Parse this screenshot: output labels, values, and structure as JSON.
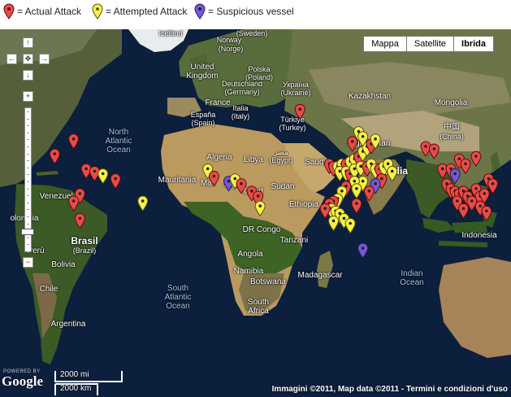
{
  "legend": {
    "actual": "= Actual Attack",
    "attempted": "= Attempted Attack",
    "suspicious": "= Suspicious vessel"
  },
  "colors": {
    "actual": "#e84b47",
    "attempted": "#f6f04b",
    "suspicious": "#7657d6",
    "ocean": "#0c1f3d"
  },
  "map_types": {
    "map": "Mappa",
    "satellite": "Satellite",
    "hybrid": "Ibrida",
    "selected": "Ibrida"
  },
  "labels": {
    "iceland": "Iceland",
    "sweden": "(Sweden)",
    "norway": "Norway",
    "norge": "(Norge)",
    "uk1": "United",
    "uk2": "Kingdom",
    "poland1": "Polska",
    "poland2": "(Poland)",
    "germany1": "Deutschland",
    "germany2": "(Germany)",
    "ukraine1": "Україна",
    "ukraine2": "(Ukraine)",
    "kazakhstan": "Kazakhstan",
    "france": "France",
    "italy1": "Italia",
    "italy2": "(Italy)",
    "spain1": "España",
    "spain2": "(Spain)",
    "turkey1": "Türkiye",
    "turkey2": "(Turkey)",
    "mongolia": "Mongolia",
    "china1": "中国",
    "china2": "(China)",
    "north_atlantic1": "North",
    "north_atlantic2": "Atlantic",
    "north_atlantic3": "Ocean",
    "algeria": "Algeria",
    "libya": "Libya",
    "egypt1": "مصر",
    "egypt2": "(Egypt)",
    "afghanistan": "Afghanistan",
    "saudi": "Saudi",
    "india": "India",
    "mauritania": "Mauritania",
    "mali": "Mali",
    "niger": "Niger",
    "chad": "Chad",
    "sudan": "Sudan",
    "venezuela": "Venezuela",
    "colombia": "olombia",
    "ethiopia": "Ethiopia",
    "drcongo": "DR Congo",
    "tanzania": "Tanzani",
    "brasil1": "Brasil",
    "brasil2": "(Brazil)",
    "peru": "Perú",
    "bolivia": "Bolivia",
    "angola": "Angola",
    "namibia": "Namibia",
    "botswana": "Botswana",
    "madagascar": "Madagascar",
    "indonesia": "Indonesia",
    "indian_ocean1": "Indian",
    "indian_ocean2": "Ocean",
    "chile": "Chile",
    "south_atlantic1": "South",
    "south_atlantic2": "Atlantic",
    "south_atlantic3": "Ocean",
    "south_africa1": "South",
    "south_africa2": "Africa",
    "argentina": "Argentina"
  },
  "footer": {
    "powered": "POWERED BY",
    "google": "Google",
    "scale_mi": "2000 mi",
    "scale_km": "2000 km",
    "copyright": "Immagini ©2011, Map data ©2011 - Termini e condizioni d'uso"
  },
  "markers": [
    {
      "t": "actual",
      "lon": -89,
      "lat": 18
    },
    {
      "t": "actual",
      "lon": -80,
      "lat": 24
    },
    {
      "t": "actual",
      "lon": -74,
      "lat": 12
    },
    {
      "t": "actual",
      "lon": -70,
      "lat": 11
    },
    {
      "t": "actual",
      "lon": -60,
      "lat": 8
    },
    {
      "t": "actual",
      "lon": -77,
      "lat": 2
    },
    {
      "t": "actual",
      "lon": -80,
      "lat": -1
    },
    {
      "t": "actual",
      "lon": -77,
      "lat": -8
    },
    {
      "t": "attempted",
      "lon": -66,
      "lat": 10
    },
    {
      "t": "attempted",
      "lon": -47,
      "lat": -1
    },
    {
      "t": "attempted",
      "lon": -16,
      "lat": 12
    },
    {
      "t": "actual",
      "lon": -13,
      "lat": 9
    },
    {
      "t": "suspicious",
      "lon": -6,
      "lat": 7
    },
    {
      "t": "attempted",
      "lon": -3,
      "lat": 8
    },
    {
      "t": "actual",
      "lon": 0,
      "lat": 6
    },
    {
      "t": "actual",
      "lon": 5,
      "lat": 3
    },
    {
      "t": "actual",
      "lon": 8,
      "lat": 1
    },
    {
      "t": "attempted",
      "lon": 9,
      "lat": -3
    },
    {
      "t": "actual",
      "lon": 28,
      "lat": 36
    },
    {
      "t": "actual",
      "lon": 42,
      "lat": 14
    },
    {
      "t": "actual",
      "lon": 44,
      "lat": 13
    },
    {
      "t": "attempted",
      "lon": 46,
      "lat": 13
    },
    {
      "t": "attempted",
      "lon": 48,
      "lat": 14
    },
    {
      "t": "actual",
      "lon": 50,
      "lat": 14
    },
    {
      "t": "attempted",
      "lon": 52,
      "lat": 15
    },
    {
      "t": "attempted",
      "lon": 54,
      "lat": 16
    },
    {
      "t": "actual",
      "lon": 56,
      "lat": 17
    },
    {
      "t": "attempted",
      "lon": 58,
      "lat": 19
    },
    {
      "t": "attempted",
      "lon": 60,
      "lat": 21
    },
    {
      "t": "actual",
      "lon": 62,
      "lat": 22
    },
    {
      "t": "attempted",
      "lon": 64,
      "lat": 24
    },
    {
      "t": "attempted",
      "lon": 56,
      "lat": 27
    },
    {
      "t": "attempted",
      "lon": 58,
      "lat": 25
    },
    {
      "t": "actual",
      "lon": 53,
      "lat": 23
    },
    {
      "t": "attempted",
      "lon": 47,
      "lat": 11
    },
    {
      "t": "attempted",
      "lon": 50,
      "lat": 11
    },
    {
      "t": "actual",
      "lon": 52,
      "lat": 10
    },
    {
      "t": "attempted",
      "lon": 54,
      "lat": 12
    },
    {
      "t": "attempted",
      "lon": 57,
      "lat": 13
    },
    {
      "t": "actual",
      "lon": 60,
      "lat": 13
    },
    {
      "t": "attempted",
      "lon": 62,
      "lat": 14
    },
    {
      "t": "attempted",
      "lon": 64,
      "lat": 12
    },
    {
      "t": "actual",
      "lon": 66,
      "lat": 12
    },
    {
      "t": "attempted",
      "lon": 68,
      "lat": 13
    },
    {
      "t": "attempted",
      "lon": 70,
      "lat": 14
    },
    {
      "t": "attempted",
      "lon": 72,
      "lat": 11
    },
    {
      "t": "actual",
      "lon": 67,
      "lat": 8
    },
    {
      "t": "suspicious",
      "lon": 64,
      "lat": 6
    },
    {
      "t": "attempted",
      "lon": 58,
      "lat": 7
    },
    {
      "t": "attempted",
      "lon": 54,
      "lat": 7
    },
    {
      "t": "actual",
      "lon": 50,
      "lat": 5
    },
    {
      "t": "attempted",
      "lon": 55,
      "lat": 4
    },
    {
      "t": "actual",
      "lon": 61,
      "lat": 3
    },
    {
      "t": "attempted",
      "lon": 48,
      "lat": 3
    },
    {
      "t": "attempted",
      "lon": 46,
      "lat": 0
    },
    {
      "t": "actual",
      "lon": 44,
      "lat": -1
    },
    {
      "t": "actual",
      "lon": 42,
      "lat": -2
    },
    {
      "t": "attempted",
      "lon": 43,
      "lat": -4
    },
    {
      "t": "attempted",
      "lon": 45,
      "lat": -5
    },
    {
      "t": "attempted",
      "lon": 47,
      "lat": -6
    },
    {
      "t": "attempted",
      "lon": 49,
      "lat": -8
    },
    {
      "t": "attempted",
      "lon": 44,
      "lat": -9
    },
    {
      "t": "actual",
      "lon": 40,
      "lat": -4
    },
    {
      "t": "attempted",
      "lon": 52,
      "lat": -10
    },
    {
      "t": "actual",
      "lon": 55,
      "lat": -2
    },
    {
      "t": "suspicious",
      "lon": 58,
      "lat": -20
    },
    {
      "t": "actual",
      "lon": 88,
      "lat": 21
    },
    {
      "t": "actual",
      "lon": 92,
      "lat": 20
    },
    {
      "t": "actual",
      "lon": 96,
      "lat": 12
    },
    {
      "t": "actual",
      "lon": 100,
      "lat": 12
    },
    {
      "t": "actual",
      "lon": 104,
      "lat": 16
    },
    {
      "t": "suspicious",
      "lon": 102,
      "lat": 10
    },
    {
      "t": "actual",
      "lon": 107,
      "lat": 14
    },
    {
      "t": "actual",
      "lon": 112,
      "lat": 17
    },
    {
      "t": "actual",
      "lon": 98,
      "lat": 6
    },
    {
      "t": "actual",
      "lon": 100,
      "lat": 4
    },
    {
      "t": "actual",
      "lon": 102,
      "lat": 3
    },
    {
      "t": "actual",
      "lon": 104,
      "lat": 2
    },
    {
      "t": "actual",
      "lon": 106,
      "lat": 3
    },
    {
      "t": "actual",
      "lon": 108,
      "lat": 1
    },
    {
      "t": "actual",
      "lon": 110,
      "lat": -1
    },
    {
      "t": "actual",
      "lon": 112,
      "lat": 4
    },
    {
      "t": "actual",
      "lon": 114,
      "lat": 1
    },
    {
      "t": "actual",
      "lon": 116,
      "lat": 2
    },
    {
      "t": "actual",
      "lon": 103,
      "lat": -1
    },
    {
      "t": "actual",
      "lon": 106,
      "lat": -4
    },
    {
      "t": "actual",
      "lon": 114,
      "lat": -3
    },
    {
      "t": "actual",
      "lon": 117,
      "lat": -5
    },
    {
      "t": "actual",
      "lon": 118,
      "lat": 8
    },
    {
      "t": "actual",
      "lon": 120,
      "lat": 6
    }
  ]
}
